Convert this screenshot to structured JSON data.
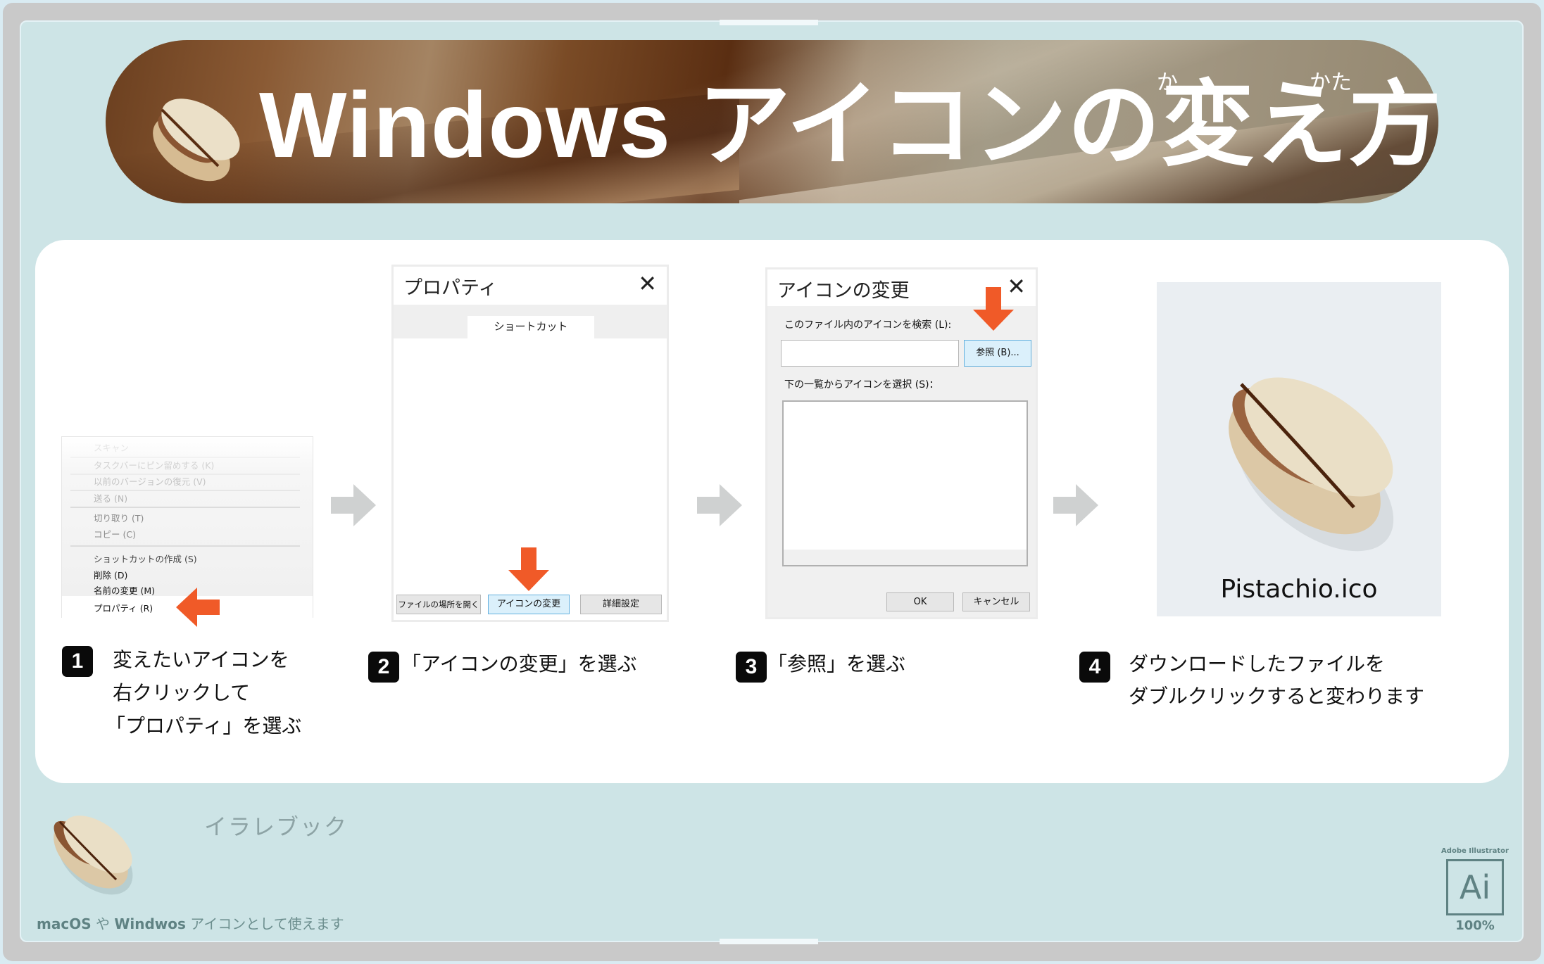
{
  "header": {
    "title": "Windows アイコンの変え方",
    "ruby_ka": "か",
    "ruby_kata": "かた"
  },
  "step1": {
    "badge": "1",
    "caption_lines": [
      "変えたいアイコンを",
      "右クリックして",
      "「プロパティ」を選ぶ"
    ],
    "menu_items": [
      {
        "label": "スキャン",
        "state": "faded"
      },
      {
        "label": "タスクバーにピン留めする (K)",
        "state": "faded"
      },
      {
        "label": "以前のバージョンの復元 (V)",
        "state": "faded"
      },
      {
        "label": "送る (N)",
        "state": "faded"
      },
      {
        "label": "切り取り (T)",
        "state": "dim"
      },
      {
        "label": "コピー (C)",
        "state": "dim"
      },
      {
        "label": "ショットカットの作成 (S)",
        "state": "normal"
      },
      {
        "label": "削除 (D)",
        "state": "normal"
      },
      {
        "label": "名前の変更 (M)",
        "state": "normal"
      },
      {
        "label": "プロパティ (R)",
        "state": "highlighted"
      }
    ]
  },
  "step2": {
    "badge": "2",
    "caption": "「アイコンの変更」を選ぶ",
    "dialog_title": "プロパティ",
    "tab_label": "ショートカット",
    "buttons": {
      "open_location": "ファイルの場所を開く",
      "change_icon": "アイコンの変更",
      "advanced": "詳細設定"
    }
  },
  "step3": {
    "badge": "3",
    "caption": "「参照」を選ぶ",
    "dialog_title": "アイコンの変更",
    "search_label": "このファイル内のアイコンを検索 (L):",
    "search_value": "",
    "browse_button": "参照 (B)...",
    "list_label": "下の一覧からアイコンを選択 (S)：",
    "ok_button": "OK",
    "cancel_button": "キャンセル"
  },
  "step4": {
    "badge": "4",
    "caption_lines": [
      "ダウンロードしたファイルを",
      "ダブルクリックすると変わります"
    ],
    "file_name": "Pistachio.ico"
  },
  "footer": {
    "brand": "イラレブック",
    "tagline_parts": [
      {
        "text": "macOS",
        "bold": true
      },
      {
        "text": " や ",
        "bold": false
      },
      {
        "text": "Windwos",
        "bold": true
      },
      {
        "text": " アイコンとして使えます",
        "bold": false
      }
    ],
    "app_label": "Adobe Illustrator",
    "app_icon_text": "Ai",
    "zoom_level": "100%"
  },
  "colors": {
    "accent_orange": "#f05a28",
    "canvas_bg": "#cde4e6",
    "frame_gray": "#c9c9c9",
    "footer_text": "#5f8283"
  }
}
